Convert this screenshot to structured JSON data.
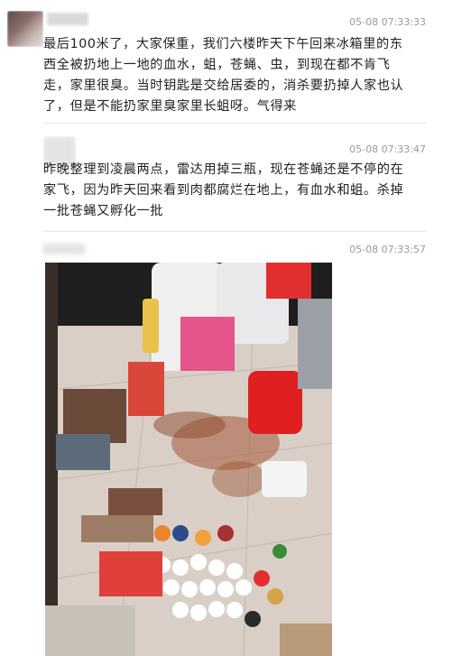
{
  "posts": [
    {
      "time": "05-08 07:33:33",
      "text": "最后100米了，大家保重，我们六楼昨天下午回来冰箱里的东西全被扔地上一地的血水，蛆，苍蝇、虫，到现在都不肯飞走，家里很臭。当时钥匙是交给居委的，消杀要扔掉人家也认了，但是不能扔家里臭家里长蛆呀。气得来"
    },
    {
      "time": "05-08 07:33:47",
      "text": "昨晚整理到凌晨两点，雷达用掉三瓶，现在苍蝇还是不停的在家飞，因为昨天回来看到肉都腐烂在地上，有血水和蛆。杀掉一批苍蝇又孵化一批"
    },
    {
      "time": "05-08 07:33:57",
      "text": ""
    }
  ]
}
